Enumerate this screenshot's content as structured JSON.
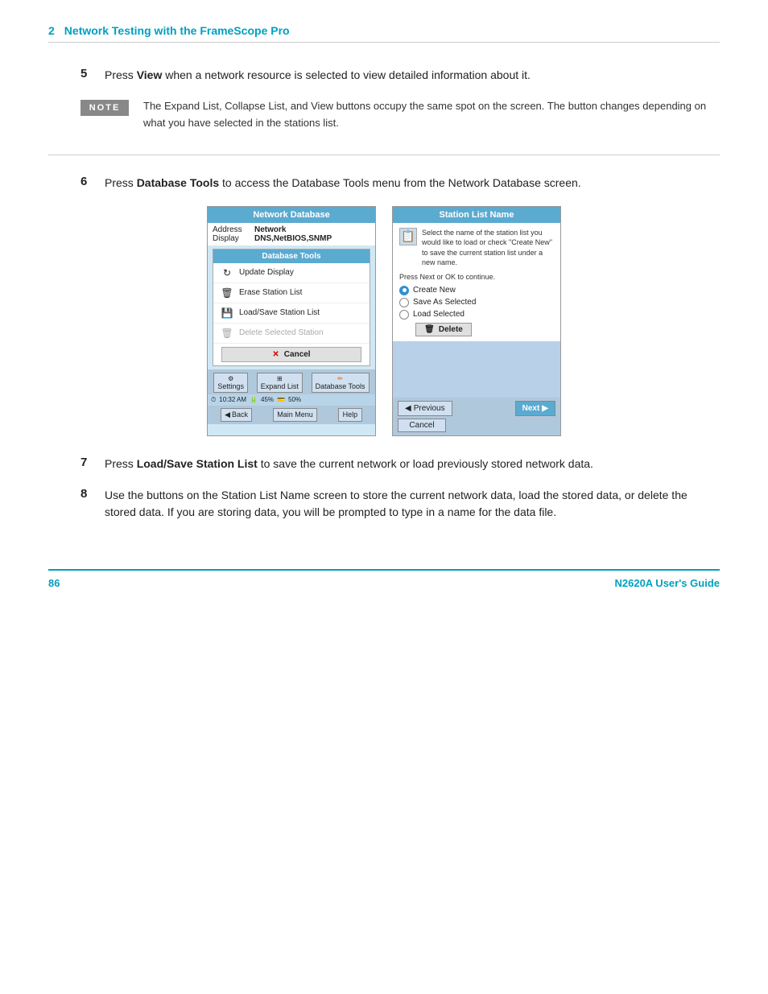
{
  "header": {
    "chapter_num": "2",
    "chapter_title": "Network Testing with the FrameScope Pro"
  },
  "steps": [
    {
      "id": "step5",
      "num": "5",
      "text_before": "Press ",
      "bold": "View",
      "text_after": " when a network resource is selected to view detailed information about it."
    },
    {
      "id": "step6",
      "num": "6",
      "text_before": "Press ",
      "bold": "Database Tools",
      "text_after": " to access the Database Tools menu from the Network Database screen."
    },
    {
      "id": "step7",
      "num": "7",
      "text_before": "Press ",
      "bold": "Load/Save Station List",
      "text_after": " to save the current network or load previously stored network data."
    },
    {
      "id": "step8",
      "num": "8",
      "text": "Use the buttons on the Station List Name screen to store the current network data, load the stored data, or delete the stored data. If you are storing data, you will be prompted to type in a name for the data file."
    }
  ],
  "note": {
    "badge": "NOTE",
    "text": "The Expand List, Collapse List, and View buttons occupy the same spot on the screen. The button changes depending on what you have selected in the stations list."
  },
  "nd_screen": {
    "title": "Network Database",
    "row1_label": "Address",
    "row1_val": "Network",
    "row2_label": "Display",
    "row2_val": "DNS,NetBIOS,SNMP",
    "popup_title": "Database Tools",
    "item1": "Update Display",
    "item2": "Erase Station List",
    "item3": "Load/Save Station List",
    "item4_disabled": "Delete Selected Station",
    "cancel": "Cancel",
    "status_time": "10:32 AM",
    "status_bat": "45%",
    "status_mem": "50%",
    "btn_back": "Back",
    "btn_main": "Main Menu",
    "btn_help": "Help",
    "btn_settings": "Settings",
    "btn_expand": "Expand List",
    "btn_db": "Database Tools"
  },
  "sln_screen": {
    "title": "Station List Name",
    "desc": "Select the name of the station list you would like to load or check \"Create New\" to save the current station list under a new name.",
    "press_next": "Press Next or OK to continue.",
    "radio_create": "Create New",
    "radio_save": "Save As Selected",
    "radio_load": "Load Selected",
    "delete_btn": "Delete",
    "btn_previous": "Previous",
    "btn_next": "Next",
    "btn_cancel": "Cancel"
  },
  "footer": {
    "page_num": "86",
    "guide_name": "N2620A User's Guide"
  }
}
